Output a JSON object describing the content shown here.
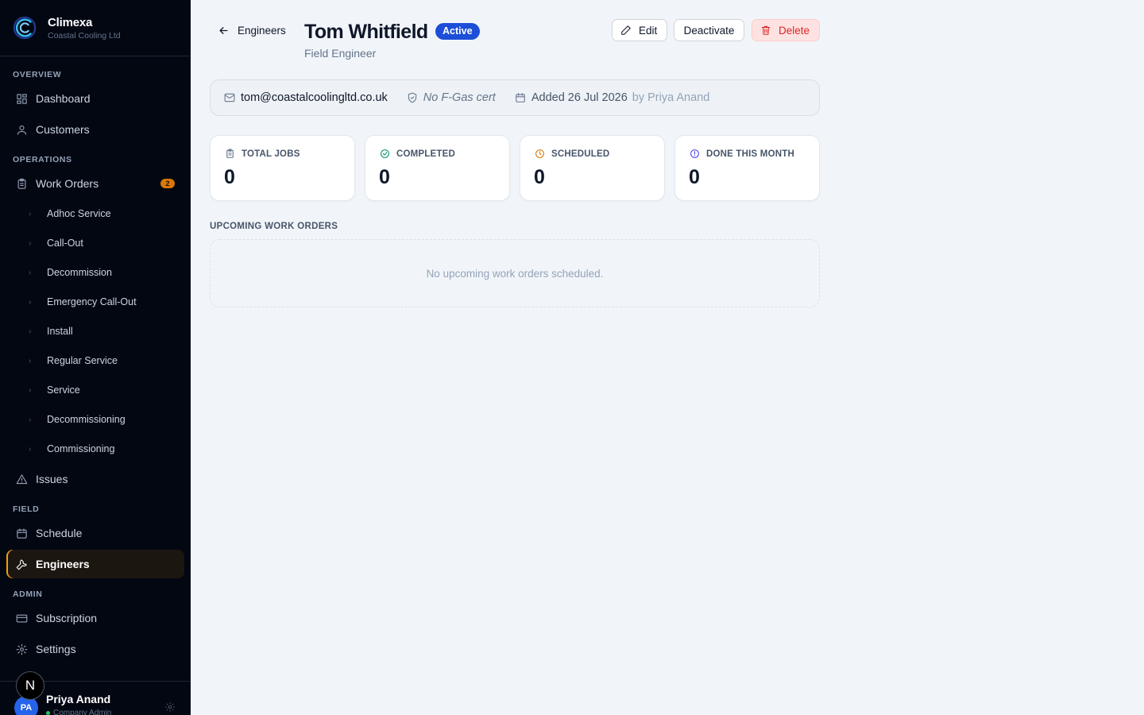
{
  "brand": {
    "name": "Climexa",
    "company": "Coastal Cooling Ltd"
  },
  "sidebar": {
    "sections": {
      "overview": "OVERVIEW",
      "operations": "OPERATIONS",
      "field": "FIELD",
      "admin": "ADMIN"
    },
    "dashboard": "Dashboard",
    "customers": "Customers",
    "work_orders": "Work Orders",
    "work_orders_badge": "2",
    "work_order_types": [
      "Adhoc Service",
      "Call-Out",
      "Decommission",
      "Emergency Call-Out",
      "Install",
      "Regular Service",
      "Service",
      "Decommissioning",
      "Commissioning"
    ],
    "issues": "Issues",
    "schedule": "Schedule",
    "engineers": "Engineers",
    "subscription": "Subscription",
    "settings": "Settings"
  },
  "user": {
    "initials": "PA",
    "name": "Priya Anand",
    "role": "Company Admin",
    "n_badge": "N"
  },
  "header": {
    "back_label": "Engineers",
    "name": "Tom Whitfield",
    "status": "Active",
    "role": "Field Engineer",
    "edit_label": "Edit",
    "deactivate_label": "Deactivate",
    "delete_label": "Delete"
  },
  "info": {
    "email": "tom@coastalcoolingltd.co.uk",
    "cert": "No F-Gas cert",
    "added": "Added 26 Jul 2026",
    "added_by": "by Priya Anand"
  },
  "stats": [
    {
      "label": "TOTAL JOBS",
      "value": "0",
      "color": "#64748b"
    },
    {
      "label": "COMPLETED",
      "value": "0",
      "color": "#059669"
    },
    {
      "label": "SCHEDULED",
      "value": "0",
      "color": "#d97706"
    },
    {
      "label": "DONE THIS MONTH",
      "value": "0",
      "color": "#4f46e5"
    }
  ],
  "upcoming": {
    "title": "UPCOMING WORK ORDERS",
    "empty": "No upcoming work orders scheduled."
  },
  "colors": {
    "accent": "#f59e0b",
    "status": "#1d4ed8",
    "danger": "#dc2626",
    "sidebar_bg": "#030712"
  }
}
